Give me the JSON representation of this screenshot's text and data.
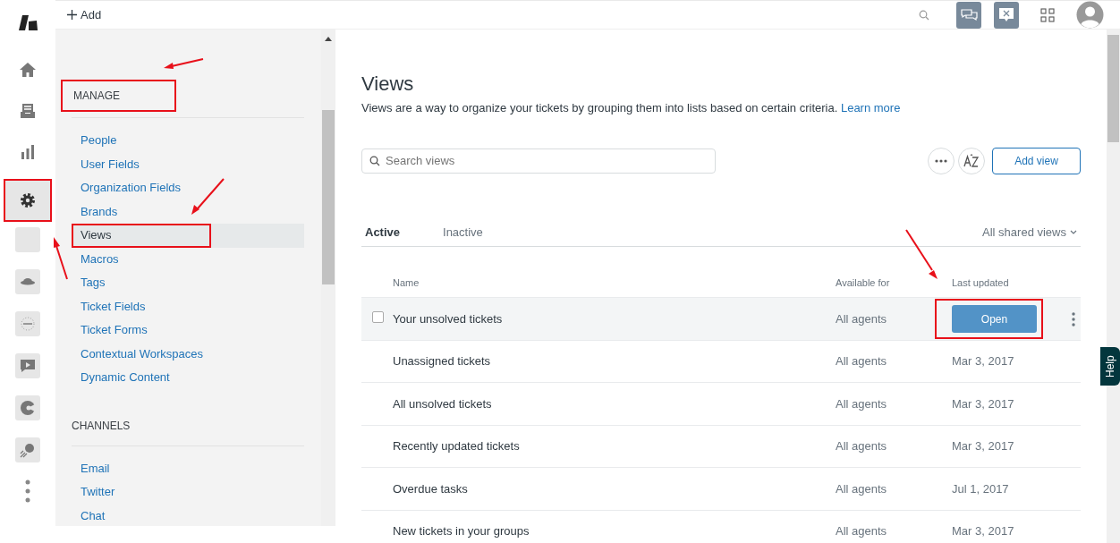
{
  "topbar": {
    "add_label": "Add"
  },
  "rail": {
    "items": [
      {
        "kind": "home",
        "selected": false,
        "annotated": false
      },
      {
        "kind": "views",
        "selected": false,
        "annotated": false
      },
      {
        "kind": "reporting",
        "selected": false,
        "annotated": false
      },
      {
        "kind": "settings",
        "selected": true,
        "annotated": true
      }
    ],
    "apps": [
      {
        "kind": "blank"
      },
      {
        "kind": "saucer"
      },
      {
        "kind": "dotted"
      },
      {
        "kind": "video"
      },
      {
        "kind": "pie"
      },
      {
        "kind": "comet"
      }
    ]
  },
  "sidebar": {
    "sections": [
      {
        "title": "MANAGE",
        "annotated": true,
        "items": [
          {
            "label": "People",
            "selected": false,
            "annotated": false
          },
          {
            "label": "User Fields",
            "selected": false,
            "annotated": false
          },
          {
            "label": "Organization Fields",
            "selected": false,
            "annotated": false
          },
          {
            "label": "Brands",
            "selected": false,
            "annotated": false
          },
          {
            "label": "Views",
            "selected": true,
            "annotated": true
          },
          {
            "label": "Macros",
            "selected": false,
            "annotated": false
          },
          {
            "label": "Tags",
            "selected": false,
            "annotated": false
          },
          {
            "label": "Ticket Fields",
            "selected": false,
            "annotated": false
          },
          {
            "label": "Ticket Forms",
            "selected": false,
            "annotated": false
          },
          {
            "label": "Contextual Workspaces",
            "selected": false,
            "annotated": false
          },
          {
            "label": "Dynamic Content",
            "selected": false,
            "annotated": false
          }
        ]
      },
      {
        "title": "CHANNELS",
        "annotated": false,
        "items": [
          {
            "label": "Email",
            "selected": false,
            "annotated": false
          },
          {
            "label": "Twitter",
            "selected": false,
            "annotated": false
          },
          {
            "label": "Chat",
            "selected": false,
            "annotated": false
          }
        ]
      }
    ]
  },
  "main": {
    "title": "Views",
    "description": "Views are a way to organize your tickets by grouping them into lists based on certain criteria.",
    "learn_more": "Learn more",
    "search": {
      "placeholder": "Search views"
    },
    "add_button": "Add view",
    "tabs": [
      {
        "label": "Active",
        "selected": true
      },
      {
        "label": "Inactive",
        "selected": false
      }
    ],
    "filter": "All shared views",
    "columns": [
      "Name",
      "Available for",
      "Last updated"
    ],
    "rows": [
      {
        "name": "Your unsolved tickets",
        "available_for": "All agents",
        "hovered": true,
        "open_button": "Open",
        "annotated": true
      },
      {
        "name": "Unassigned tickets",
        "available_for": "All agents",
        "last_updated": "Mar 3, 2017",
        "hovered": false,
        "annotated": false
      },
      {
        "name": "All unsolved tickets",
        "available_for": "All agents",
        "last_updated": "Mar 3, 2017",
        "hovered": false,
        "annotated": false
      },
      {
        "name": "Recently updated tickets",
        "available_for": "All agents",
        "last_updated": "Mar 3, 2017",
        "hovered": false,
        "annotated": false
      },
      {
        "name": "Overdue tasks",
        "available_for": "All agents",
        "last_updated": "Jul 1, 2017",
        "hovered": false,
        "annotated": false
      },
      {
        "name": "New tickets in your groups",
        "available_for": "All agents",
        "last_updated": "Mar 3, 2017",
        "hovered": false,
        "annotated": false
      }
    ]
  },
  "help_tab": "Help"
}
